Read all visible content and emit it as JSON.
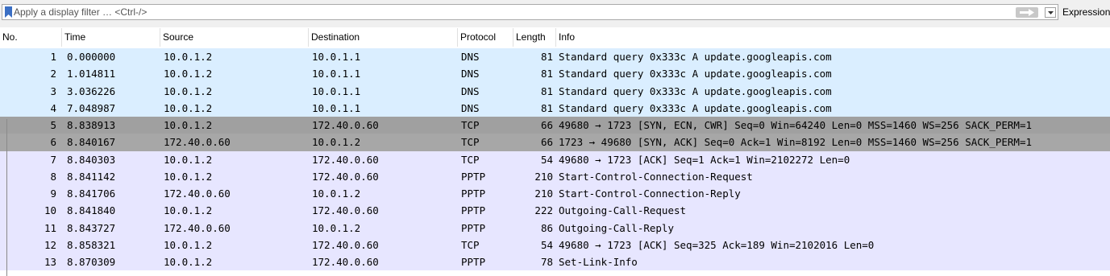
{
  "filter": {
    "placeholder": "Apply a display filter … <Ctrl-/>",
    "expression_label": "Expression"
  },
  "columns": [
    "No.",
    "Time",
    "Source",
    "Destination",
    "Protocol",
    "Length",
    "Info"
  ],
  "packets": [
    {
      "no": "1",
      "time": "0.000000",
      "src": "10.0.1.2",
      "dst": "10.0.1.1",
      "proto": "DNS",
      "len": "81",
      "info": "Standard query 0x333c A update.googleapis.com",
      "style": "dns"
    },
    {
      "no": "2",
      "time": "1.014811",
      "src": "10.0.1.2",
      "dst": "10.0.1.1",
      "proto": "DNS",
      "len": "81",
      "info": "Standard query 0x333c A update.googleapis.com",
      "style": "dns"
    },
    {
      "no": "3",
      "time": "3.036226",
      "src": "10.0.1.2",
      "dst": "10.0.1.1",
      "proto": "DNS",
      "len": "81",
      "info": "Standard query 0x333c A update.googleapis.com",
      "style": "dns"
    },
    {
      "no": "4",
      "time": "7.048987",
      "src": "10.0.1.2",
      "dst": "10.0.1.1",
      "proto": "DNS",
      "len": "81",
      "info": "Standard query 0x333c A update.googleapis.com",
      "style": "dns"
    },
    {
      "no": "5",
      "time": "8.838913",
      "src": "10.0.1.2",
      "dst": "172.40.0.60",
      "proto": "TCP",
      "len": "66",
      "info": "49680 → 1723 [SYN, ECN, CWR] Seq=0 Win=64240 Len=0 MSS=1460 WS=256 SACK_PERM=1",
      "style": "sel"
    },
    {
      "no": "6",
      "time": "8.840167",
      "src": "172.40.0.60",
      "dst": "10.0.1.2",
      "proto": "TCP",
      "len": "66",
      "info": "1723 → 49680 [SYN, ACK] Seq=0 Ack=1 Win=8192 Len=0 MSS=1460 WS=256 SACK_PERM=1",
      "style": "sel2"
    },
    {
      "no": "7",
      "time": "8.840303",
      "src": "10.0.1.2",
      "dst": "172.40.0.60",
      "proto": "TCP",
      "len": "54",
      "info": "49680 → 1723 [ACK] Seq=1 Ack=1 Win=2102272 Len=0",
      "style": "tcp"
    },
    {
      "no": "8",
      "time": "8.841142",
      "src": "10.0.1.2",
      "dst": "172.40.0.60",
      "proto": "PPTP",
      "len": "210",
      "info": "Start-Control-Connection-Request",
      "style": "tcp"
    },
    {
      "no": "9",
      "time": "8.841706",
      "src": "172.40.0.60",
      "dst": "10.0.1.2",
      "proto": "PPTP",
      "len": "210",
      "info": "Start-Control-Connection-Reply",
      "style": "tcp"
    },
    {
      "no": "10",
      "time": "8.841840",
      "src": "10.0.1.2",
      "dst": "172.40.0.60",
      "proto": "PPTP",
      "len": "222",
      "info": "Outgoing-Call-Request",
      "style": "tcp"
    },
    {
      "no": "11",
      "time": "8.843727",
      "src": "172.40.0.60",
      "dst": "10.0.1.2",
      "proto": "PPTP",
      "len": "86",
      "info": "Outgoing-Call-Reply",
      "style": "tcp"
    },
    {
      "no": "12",
      "time": "8.858321",
      "src": "10.0.1.2",
      "dst": "172.40.0.60",
      "proto": "TCP",
      "len": "54",
      "info": "49680 → 1723 [ACK] Seq=325 Ack=189 Win=2102016 Len=0",
      "style": "tcp"
    },
    {
      "no": "13",
      "time": "8.870309",
      "src": "10.0.1.2",
      "dst": "172.40.0.60",
      "proto": "PPTP",
      "len": "78",
      "info": "Set-Link-Info",
      "style": "tcp"
    }
  ],
  "colors": {
    "dns_row": "#daeeff",
    "tcp_row": "#e7e6ff",
    "selected_row": "#a0a0a0",
    "bookmark": "#3b6fc4"
  }
}
